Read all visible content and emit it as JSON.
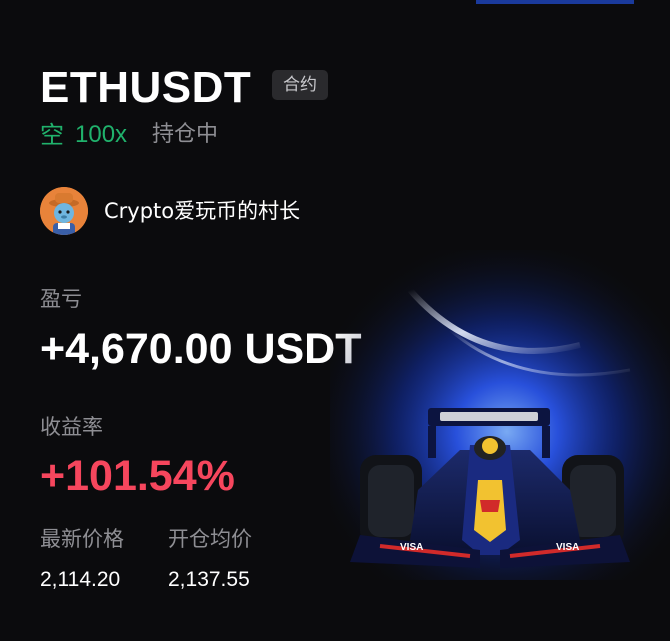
{
  "position": {
    "symbol": "ETHUSDT",
    "badge": "合约",
    "direction": "空",
    "leverage": "100x",
    "status": "持仓中"
  },
  "user": {
    "name": "Crypto爱玩币的村长",
    "avatar_icon": "cartoon-avatar-icon"
  },
  "stats": {
    "pnl_label": "盈亏",
    "pnl_value": "+4,670.00 USDT",
    "roi_label": "收益率",
    "roi_value": "+101.54%",
    "last_price_label": "最新价格",
    "last_price_value": "2,114.20",
    "entry_price_label": "开仓均价",
    "entry_price_value": "2,137.55"
  },
  "art": {
    "icon": "f1-race-car-icon"
  },
  "colors": {
    "background": "#0b0b0d",
    "short_green": "#20b26c",
    "profit_red": "#f6465d",
    "muted_gray": "#8e8e93",
    "badge_bg": "#2a2a2d"
  }
}
